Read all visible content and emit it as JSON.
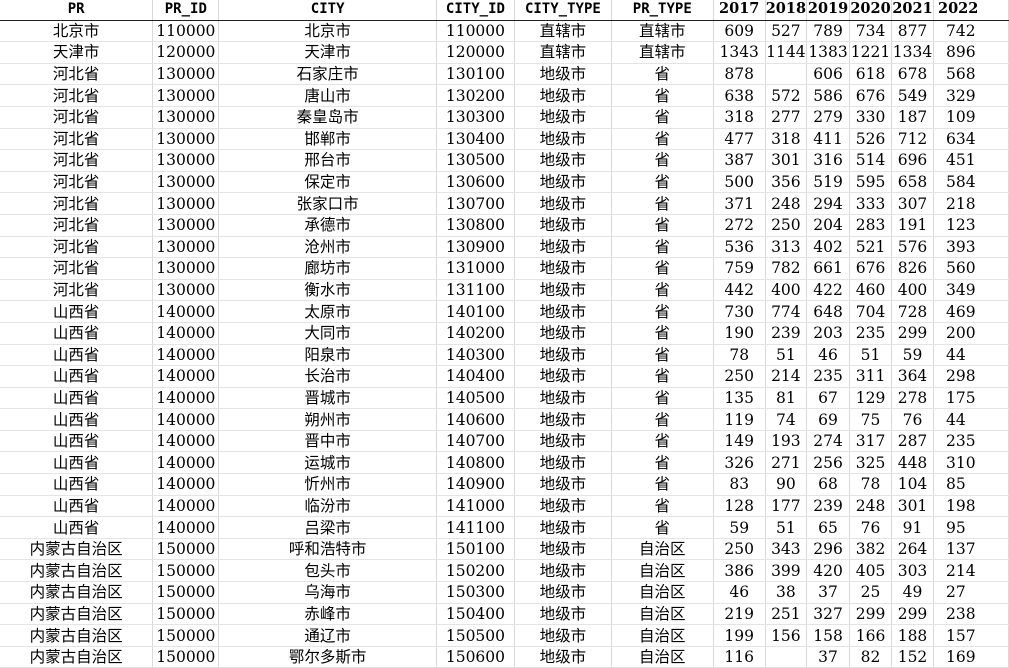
{
  "columns": [
    "PR",
    "PR_ID",
    "CITY",
    "CITY_ID",
    "CITY_TYPE",
    "PR_TYPE",
    "2017",
    "2018",
    "2019",
    "2020",
    "2021",
    "2022"
  ],
  "rows": [
    [
      "北京市",
      "110000",
      "北京市",
      "110000",
      "直辖市",
      "直辖市",
      "609",
      "527",
      "789",
      "734",
      "877",
      "742"
    ],
    [
      "天津市",
      "120000",
      "天津市",
      "120000",
      "直辖市",
      "直辖市",
      "1343",
      "1144",
      "1383",
      "1221",
      "1334",
      "896"
    ],
    [
      "河北省",
      "130000",
      "石家庄市",
      "130100",
      "地级市",
      "省",
      "878",
      "",
      "606",
      "618",
      "678",
      "568"
    ],
    [
      "河北省",
      "130000",
      "唐山市",
      "130200",
      "地级市",
      "省",
      "638",
      "572",
      "586",
      "676",
      "549",
      "329"
    ],
    [
      "河北省",
      "130000",
      "秦皇岛市",
      "130300",
      "地级市",
      "省",
      "318",
      "277",
      "279",
      "330",
      "187",
      "109"
    ],
    [
      "河北省",
      "130000",
      "邯郸市",
      "130400",
      "地级市",
      "省",
      "477",
      "318",
      "411",
      "526",
      "712",
      "634"
    ],
    [
      "河北省",
      "130000",
      "邢台市",
      "130500",
      "地级市",
      "省",
      "387",
      "301",
      "316",
      "514",
      "696",
      "451"
    ],
    [
      "河北省",
      "130000",
      "保定市",
      "130600",
      "地级市",
      "省",
      "500",
      "356",
      "519",
      "595",
      "658",
      "584"
    ],
    [
      "河北省",
      "130000",
      "张家口市",
      "130700",
      "地级市",
      "省",
      "371",
      "248",
      "294",
      "333",
      "307",
      "218"
    ],
    [
      "河北省",
      "130000",
      "承德市",
      "130800",
      "地级市",
      "省",
      "272",
      "250",
      "204",
      "283",
      "191",
      "123"
    ],
    [
      "河北省",
      "130000",
      "沧州市",
      "130900",
      "地级市",
      "省",
      "536",
      "313",
      "402",
      "521",
      "576",
      "393"
    ],
    [
      "河北省",
      "130000",
      "廊坊市",
      "131000",
      "地级市",
      "省",
      "759",
      "782",
      "661",
      "676",
      "826",
      "560"
    ],
    [
      "河北省",
      "130000",
      "衡水市",
      "131100",
      "地级市",
      "省",
      "442",
      "400",
      "422",
      "460",
      "400",
      "349"
    ],
    [
      "山西省",
      "140000",
      "太原市",
      "140100",
      "地级市",
      "省",
      "730",
      "774",
      "648",
      "704",
      "728",
      "469"
    ],
    [
      "山西省",
      "140000",
      "大同市",
      "140200",
      "地级市",
      "省",
      "190",
      "239",
      "203",
      "235",
      "299",
      "200"
    ],
    [
      "山西省",
      "140000",
      "阳泉市",
      "140300",
      "地级市",
      "省",
      "78",
      "51",
      "46",
      "51",
      "59",
      "44"
    ],
    [
      "山西省",
      "140000",
      "长治市",
      "140400",
      "地级市",
      "省",
      "250",
      "214",
      "235",
      "311",
      "364",
      "298"
    ],
    [
      "山西省",
      "140000",
      "晋城市",
      "140500",
      "地级市",
      "省",
      "135",
      "81",
      "67",
      "129",
      "278",
      "175"
    ],
    [
      "山西省",
      "140000",
      "朔州市",
      "140600",
      "地级市",
      "省",
      "119",
      "74",
      "69",
      "75",
      "76",
      "44"
    ],
    [
      "山西省",
      "140000",
      "晋中市",
      "140700",
      "地级市",
      "省",
      "149",
      "193",
      "274",
      "317",
      "287",
      "235"
    ],
    [
      "山西省",
      "140000",
      "运城市",
      "140800",
      "地级市",
      "省",
      "326",
      "271",
      "256",
      "325",
      "448",
      "310"
    ],
    [
      "山西省",
      "140000",
      "忻州市",
      "140900",
      "地级市",
      "省",
      "83",
      "90",
      "68",
      "78",
      "104",
      "85"
    ],
    [
      "山西省",
      "140000",
      "临汾市",
      "141000",
      "地级市",
      "省",
      "128",
      "177",
      "239",
      "248",
      "301",
      "198"
    ],
    [
      "山西省",
      "140000",
      "吕梁市",
      "141100",
      "地级市",
      "省",
      "59",
      "51",
      "65",
      "76",
      "91",
      "95"
    ],
    [
      "内蒙古自治区",
      "150000",
      "呼和浩特市",
      "150100",
      "地级市",
      "自治区",
      "250",
      "343",
      "296",
      "382",
      "264",
      "137"
    ],
    [
      "内蒙古自治区",
      "150000",
      "包头市",
      "150200",
      "地级市",
      "自治区",
      "386",
      "399",
      "420",
      "405",
      "303",
      "214"
    ],
    [
      "内蒙古自治区",
      "150000",
      "乌海市",
      "150300",
      "地级市",
      "自治区",
      "46",
      "38",
      "37",
      "25",
      "49",
      "27"
    ],
    [
      "内蒙古自治区",
      "150000",
      "赤峰市",
      "150400",
      "地级市",
      "自治区",
      "219",
      "251",
      "327",
      "299",
      "299",
      "238"
    ],
    [
      "内蒙古自治区",
      "150000",
      "通辽市",
      "150500",
      "地级市",
      "自治区",
      "199",
      "156",
      "158",
      "166",
      "188",
      "157"
    ],
    [
      "内蒙古自治区",
      "150000",
      "鄂尔多斯市",
      "150600",
      "地级市",
      "自治区",
      "116",
      "",
      "37",
      "82",
      "152",
      "169"
    ]
  ]
}
